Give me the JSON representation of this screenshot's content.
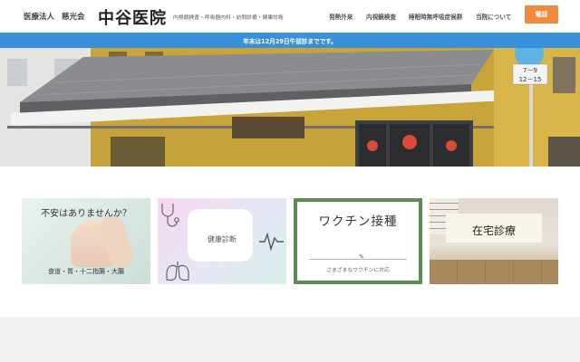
{
  "header": {
    "org_type": "医療法人",
    "org_name": "慈光会",
    "logo": "中谷医院",
    "tagline": "内視鏡検査・呼吸器内科・訪問診療・健康診断",
    "nav": [
      {
        "label": "発熱外来"
      },
      {
        "label": "内視鏡検査"
      },
      {
        "label": "睡眠時無呼吸症候群"
      },
      {
        "label": "当院について"
      }
    ],
    "phone_label": "電話",
    "colors": {
      "phone_button": "#f08a3c"
    }
  },
  "notice": {
    "text": "年末は12月29日午前診までです。",
    "color": "#3a8fd9"
  },
  "hero": {
    "sign_text_1": "7－9",
    "sign_text_2": "12－15"
  },
  "cards": [
    {
      "title": "不安はありませんか？",
      "subtitle": "食道・胃・十二指腸・大腸"
    },
    {
      "title": "健康診断"
    },
    {
      "title": "ワクチン接種",
      "subtitle": "さまざまなワクチンに対応",
      "border_color": "#5a8e52"
    },
    {
      "title": "在宅診療"
    }
  ],
  "icons": [
    "stethoscope-icon",
    "lungs-icon",
    "heartbeat-icon",
    "pen-icon"
  ]
}
